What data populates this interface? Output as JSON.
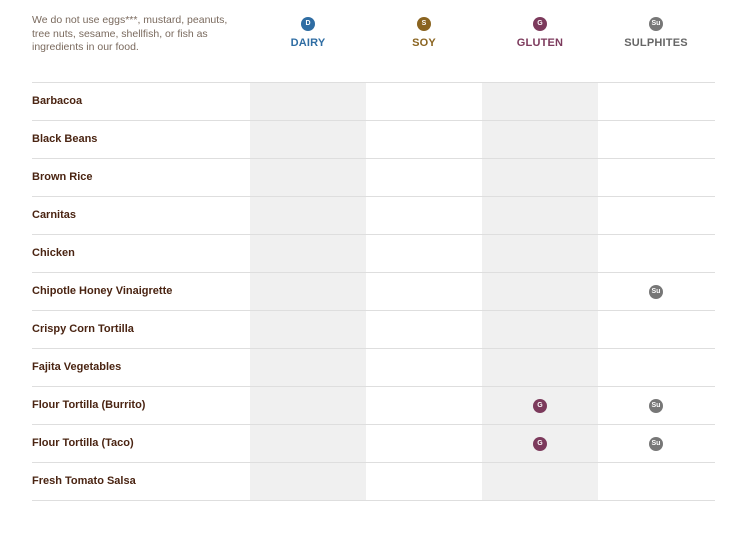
{
  "intro_note": "We do not use eggs***, mustard, peanuts, tree nuts, sesame, shellfish, or fish as ingredients in our food.",
  "allergens": [
    {
      "key": "dairy",
      "abbr": "D",
      "label": "DAIRY",
      "color": "#2f6da3"
    },
    {
      "key": "soy",
      "abbr": "S",
      "label": "SOY",
      "color": "#8a6420"
    },
    {
      "key": "gluten",
      "abbr": "G",
      "label": "GLUTEN",
      "color": "#7c3a5c"
    },
    {
      "key": "sulph",
      "abbr": "Su",
      "label": "SULPHITES",
      "color": "#777777"
    }
  ],
  "rows": [
    {
      "name": "Barbacoa",
      "dairy": false,
      "soy": false,
      "gluten": false,
      "sulph": false
    },
    {
      "name": "Black Beans",
      "dairy": false,
      "soy": false,
      "gluten": false,
      "sulph": false
    },
    {
      "name": "Brown Rice",
      "dairy": false,
      "soy": false,
      "gluten": false,
      "sulph": false
    },
    {
      "name": "Carnitas",
      "dairy": false,
      "soy": false,
      "gluten": false,
      "sulph": false
    },
    {
      "name": "Chicken",
      "dairy": false,
      "soy": false,
      "gluten": false,
      "sulph": false
    },
    {
      "name": "Chipotle Honey Vinaigrette",
      "dairy": false,
      "soy": false,
      "gluten": false,
      "sulph": true
    },
    {
      "name": "Crispy Corn Tortilla",
      "dairy": false,
      "soy": false,
      "gluten": false,
      "sulph": false
    },
    {
      "name": "Fajita Vegetables",
      "dairy": false,
      "soy": false,
      "gluten": false,
      "sulph": false
    },
    {
      "name": "Flour Tortilla (Burrito)",
      "dairy": false,
      "soy": false,
      "gluten": true,
      "sulph": true
    },
    {
      "name": "Flour Tortilla (Taco)",
      "dairy": false,
      "soy": false,
      "gluten": true,
      "sulph": true
    },
    {
      "name": "Fresh Tomato Salsa",
      "dairy": false,
      "soy": false,
      "gluten": false,
      "sulph": false
    },
    {
      "name": "",
      "dairy": false,
      "soy": false,
      "gluten": false,
      "sulph": false
    }
  ]
}
